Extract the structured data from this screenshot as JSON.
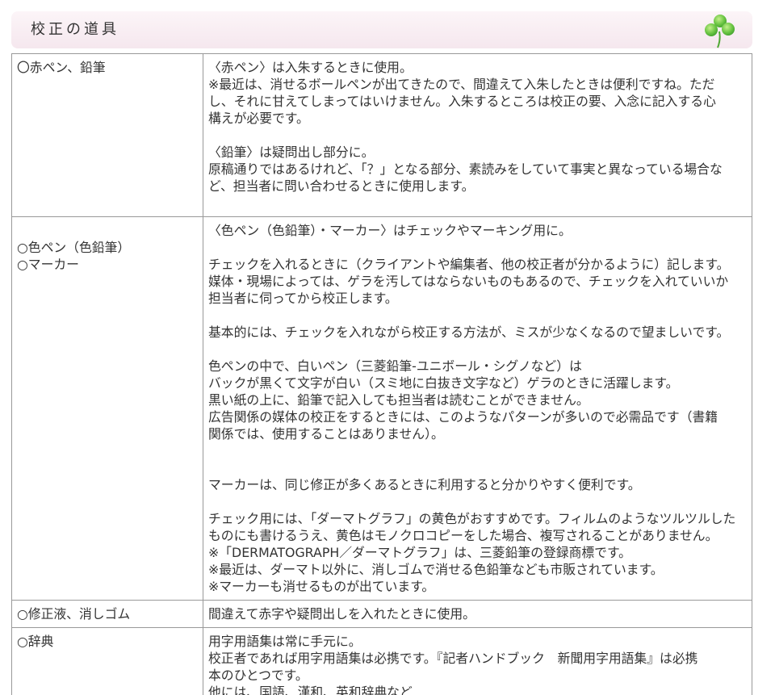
{
  "header": {
    "title": "校正の道具",
    "icon": "clover-icon"
  },
  "colors": {
    "header_bg": "#f8edf2",
    "clover_green": "#5cb83a",
    "border": "#999999",
    "text": "#333333"
  },
  "rows": [
    {
      "tool": [
        "〇赤ペン、鉛筆"
      ],
      "description": [
        "〈赤ペン〉は入朱するときに使用。",
        "※最近は、消せるボールペンが出てきたので、間違えて入朱したときは便利ですね。ただ",
        "し、それに甘えてしまってはいけません。入朱するところは校正の要、入念に記入する心",
        "構えが必要です。",
        "〈鉛筆〉は疑問出し部分に。",
        "原稿通りではあるけれど、「？」となる部分、素読みをしていて事実と異なっている場合な",
        "ど、担当者に問い合わせるときに使用します。"
      ]
    },
    {
      "tool": [
        "○色ペン（色鉛筆）",
        "○マーカー"
      ],
      "description": [
        "〈色ペン（色鉛筆）・マーカー〉はチェックやマーキング用に。",
        "チェックを入れるときに（クライアントや編集者、他の校正者が分かるように）記します。",
        "媒体・現場によっては、ゲラを汚してはならないものもあるので、チェックを入れていいか",
        "担当者に伺ってから校正します。",
        "基本的には、チェックを入れながら校正する方法が、ミスが少なくなるので望ましいです。",
        "色ペンの中で、白いペン（三菱鉛筆-ユニボール・シグノなど）は",
        "バックが黒くて文字が白い（スミ地に白抜き文字など）ゲラのときに活躍します。",
        "黒い紙の上に、鉛筆で記入しても担当者は読むことができません。",
        "広告関係の媒体の校正をするときには、このようなパターンが多いので必需品です（書籍",
        "関係では、使用することはありません）。",
        "マーカーは、同じ修正が多くあるときに利用すると分かりやすく便利です。",
        "チェック用には、「ダーマトグラフ」の黄色がおすすめです。フィルムのようなツルツルした",
        "ものにも書けるうえ、黄色はモノクロコピーをした場合、複写されることがありません。",
        "※「DERMATOGRAPH／ダーマトグラフ」は、三菱鉛筆の登録商標です。",
        "※最近は、ダーマト以外に、消しゴムで消せる色鉛筆なども市販されています。",
        "※マーカーも消せるものが出ています。"
      ]
    },
    {
      "tool": [
        "○修正液、消しゴム"
      ],
      "description": [
        "間違えて赤字や疑問出しを入れたときに使用。"
      ]
    },
    {
      "tool": [
        "○辞典"
      ],
      "description": [
        "用字用語集は常に手元に。",
        "校正者であれば用字用語集は必携です。『記者ハンドブック　新聞用字用語集』は必携",
        "本のひとつです。",
        "他には、国語、漢和、英和辞典など"
      ]
    }
  ]
}
